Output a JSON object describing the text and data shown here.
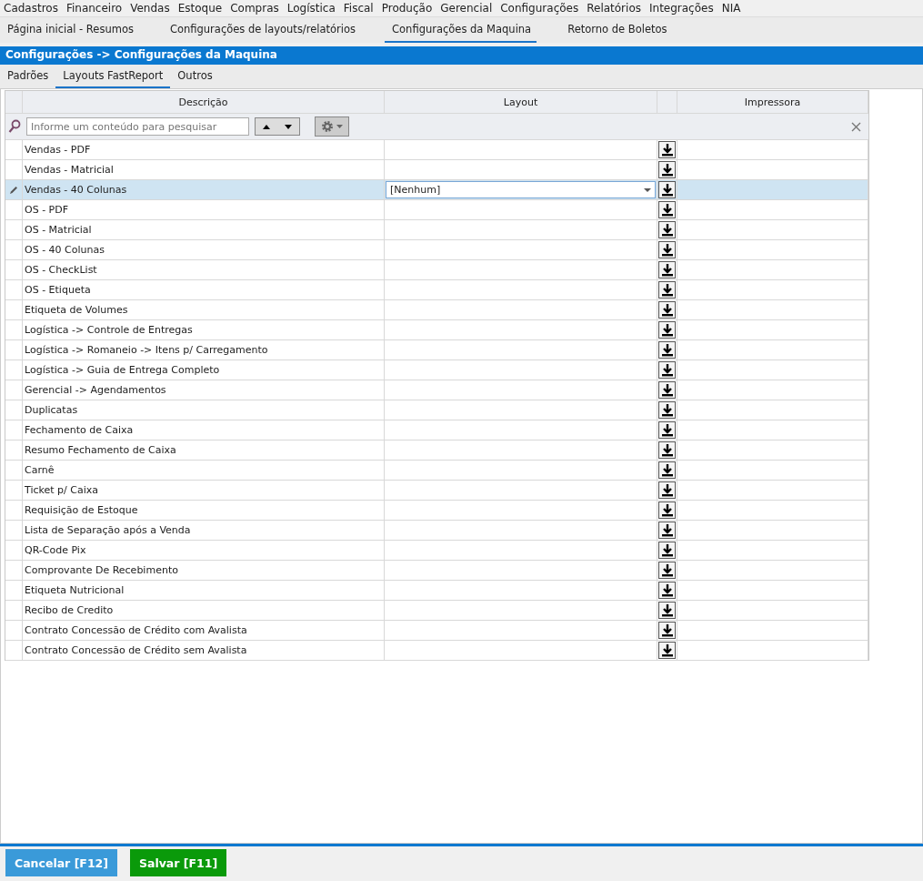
{
  "menu": [
    "Cadastros",
    "Financeiro",
    "Vendas",
    "Estoque",
    "Compras",
    "Logística",
    "Fiscal",
    "Produção",
    "Gerencial",
    "Configurações",
    "Relatórios",
    "Integrações",
    "NIA"
  ],
  "tabs": [
    {
      "label": "Página inicial - Resumos",
      "selected": false
    },
    {
      "label": "Configurações de layouts/relatórios",
      "selected": false
    },
    {
      "label": "Configurações da Maquina",
      "selected": true
    },
    {
      "label": "Retorno de Boletos",
      "selected": false
    }
  ],
  "panel_title": "Configurações -> Configurações da Maquina",
  "subtabs": [
    {
      "label": "Padrões",
      "selected": false
    },
    {
      "label": "Layouts FastReport",
      "selected": true
    },
    {
      "label": "Outros",
      "selected": false
    }
  ],
  "table": {
    "columns": [
      "Descrição",
      "Layout",
      "Impressora"
    ],
    "search": {
      "placeholder": "Informe um conteúdo para pesquisar"
    },
    "rows": [
      {
        "descricao": "Vendas - PDF",
        "selected": false
      },
      {
        "descricao": "Vendas - Matricial",
        "selected": false
      },
      {
        "descricao": "Vendas - 40 Colunas",
        "layout": "[Nenhum]",
        "selected": true
      },
      {
        "descricao": "OS - PDF",
        "selected": false
      },
      {
        "descricao": "OS - Matricial",
        "selected": false
      },
      {
        "descricao": "OS - 40 Colunas",
        "selected": false
      },
      {
        "descricao": "OS - CheckList",
        "selected": false
      },
      {
        "descricao": "OS - Etiqueta",
        "selected": false
      },
      {
        "descricao": "Etiqueta de Volumes",
        "selected": false
      },
      {
        "descricao": "Logística -> Controle de Entregas",
        "selected": false
      },
      {
        "descricao": "Logística -> Romaneio -> Itens p/ Carregamento",
        "selected": false
      },
      {
        "descricao": "Logística -> Guia de Entrega Completo",
        "selected": false
      },
      {
        "descricao": "Gerencial -> Agendamentos",
        "selected": false
      },
      {
        "descricao": "Duplicatas",
        "selected": false
      },
      {
        "descricao": "Fechamento de Caixa",
        "selected": false
      },
      {
        "descricao": "Resumo Fechamento de Caixa",
        "selected": false
      },
      {
        "descricao": "Carnê",
        "selected": false
      },
      {
        "descricao": "Ticket p/ Caixa",
        "selected": false
      },
      {
        "descricao": "Requisição de Estoque",
        "selected": false
      },
      {
        "descricao": "Lista de Separação após a Venda",
        "selected": false
      },
      {
        "descricao": "QR-Code Pix",
        "selected": false
      },
      {
        "descricao": "Comprovante De Recebimento",
        "selected": false
      },
      {
        "descricao": "Etiqueta Nutricional",
        "selected": false
      },
      {
        "descricao": "Recibo de Credito",
        "selected": false
      },
      {
        "descricao": "Contrato Concessão de Crédito com Avalista",
        "selected": false
      },
      {
        "descricao": "Contrato Concessão de Crédito sem Avalista",
        "selected": false
      }
    ]
  },
  "buttons": [
    {
      "label": "Cancelar [F12]",
      "kind": "cancel"
    },
    {
      "label": "Salvar [F11]",
      "kind": "save"
    }
  ]
}
